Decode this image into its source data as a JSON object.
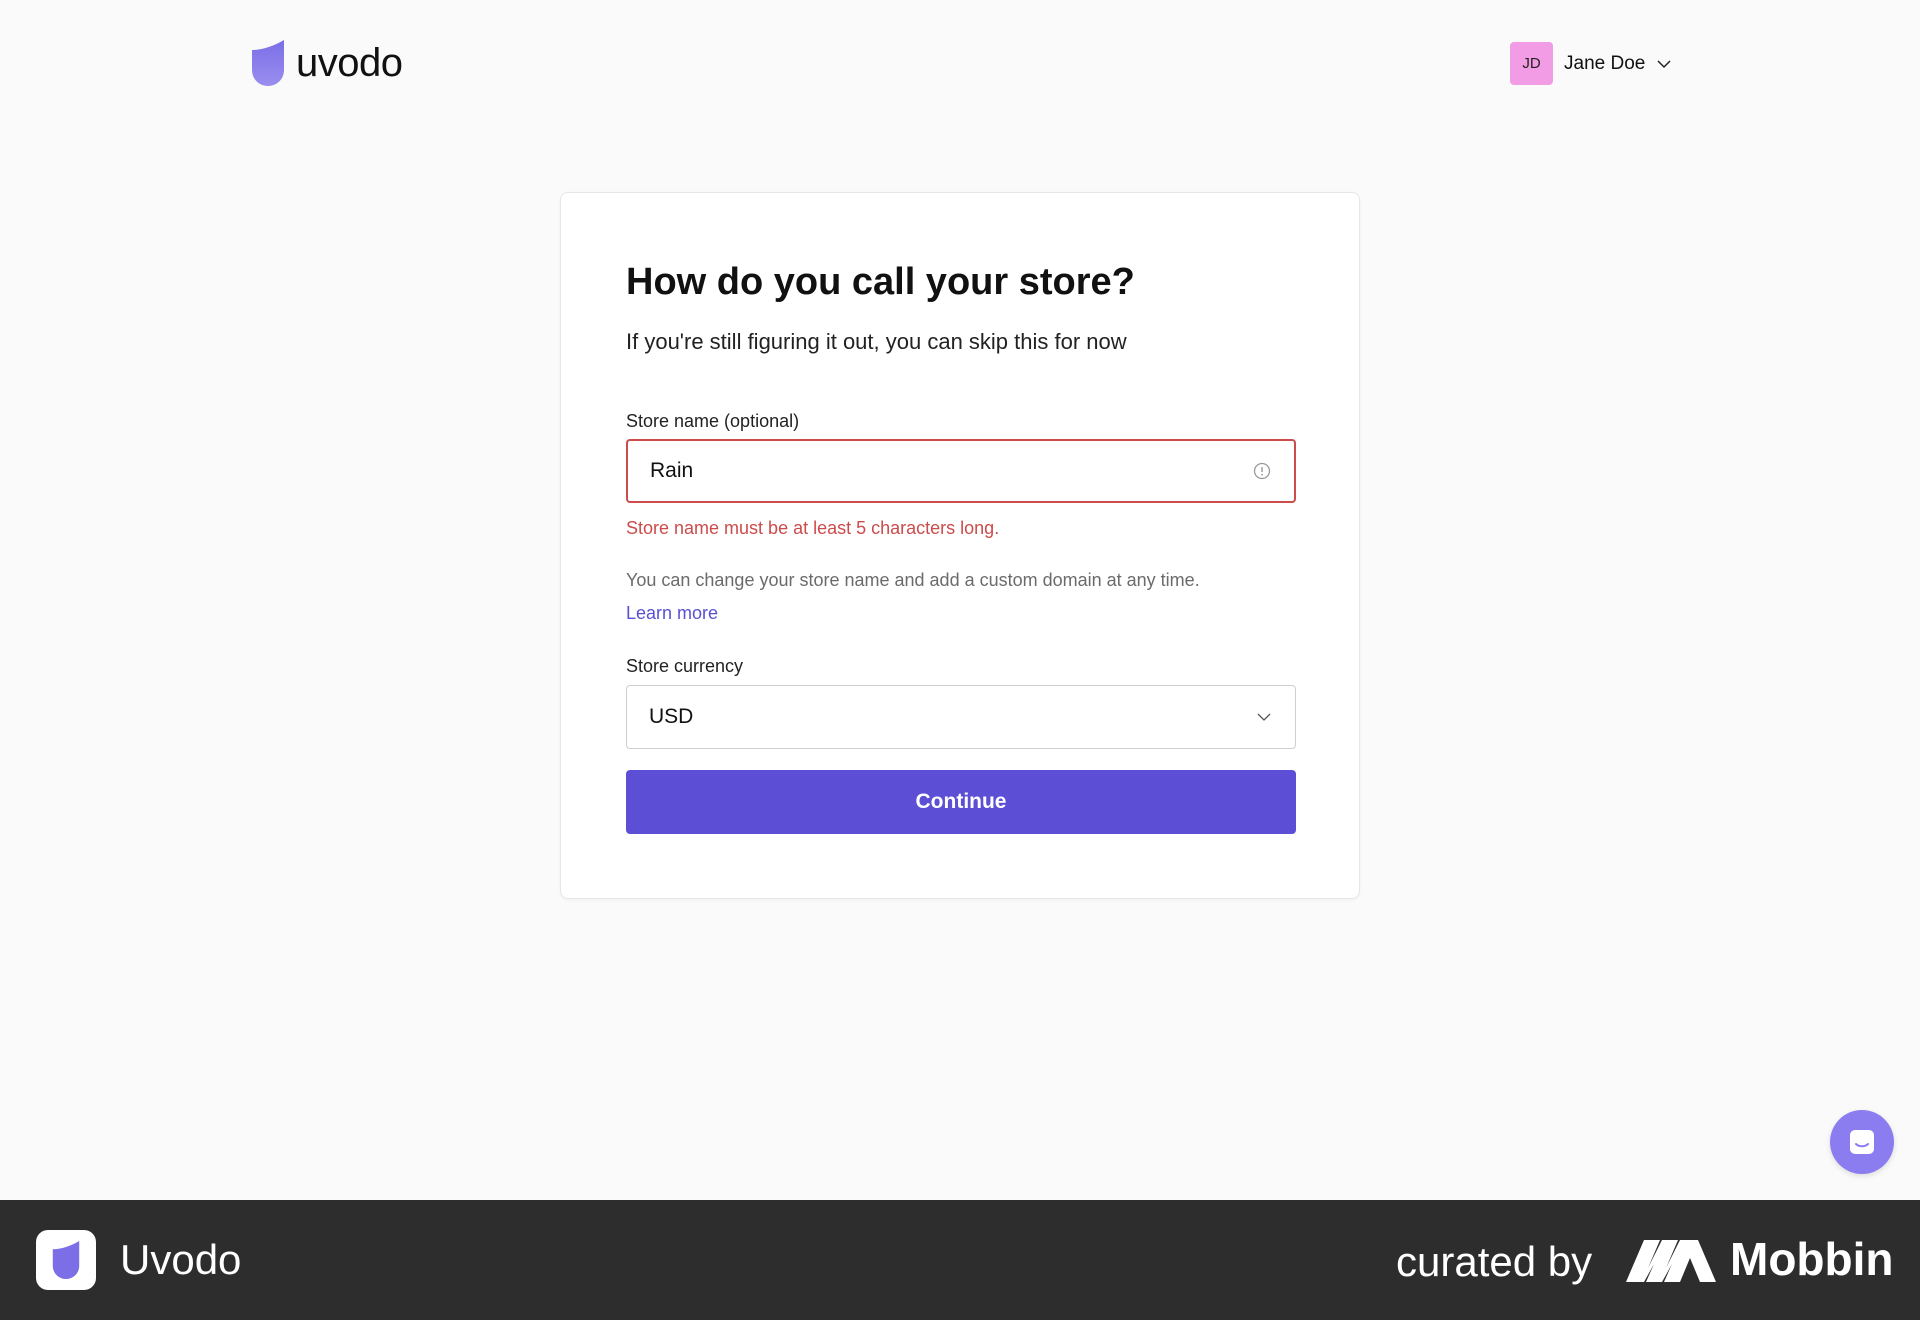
{
  "header": {
    "brand": "uvodo",
    "user": {
      "initials": "JD",
      "name": "Jane Doe"
    }
  },
  "form": {
    "title": "How do you call your store?",
    "subtitle": "If you're still figuring it out, you can skip this for now",
    "store_name": {
      "label": "Store name (optional)",
      "value": "Rain",
      "error": "Store name must be at least 5 characters long."
    },
    "hint": "You can change your store name and add a custom domain at any time.",
    "learn_more": "Learn more",
    "currency": {
      "label": "Store currency",
      "value": "USD"
    },
    "continue_label": "Continue"
  },
  "footer": {
    "app_name": "Uvodo",
    "curated_by": "curated by",
    "brand": "Mobbin"
  },
  "colors": {
    "accent": "#5c4fd6",
    "error": "#cc4b4b",
    "avatar": "#f19ce4",
    "chat": "#8b7cf0",
    "footer_bg": "#2d2d2d"
  },
  "icons": [
    "uvodo-logo-icon",
    "chevron-down-icon",
    "info-icon",
    "chat-icon",
    "mobbin-logo-icon"
  ]
}
